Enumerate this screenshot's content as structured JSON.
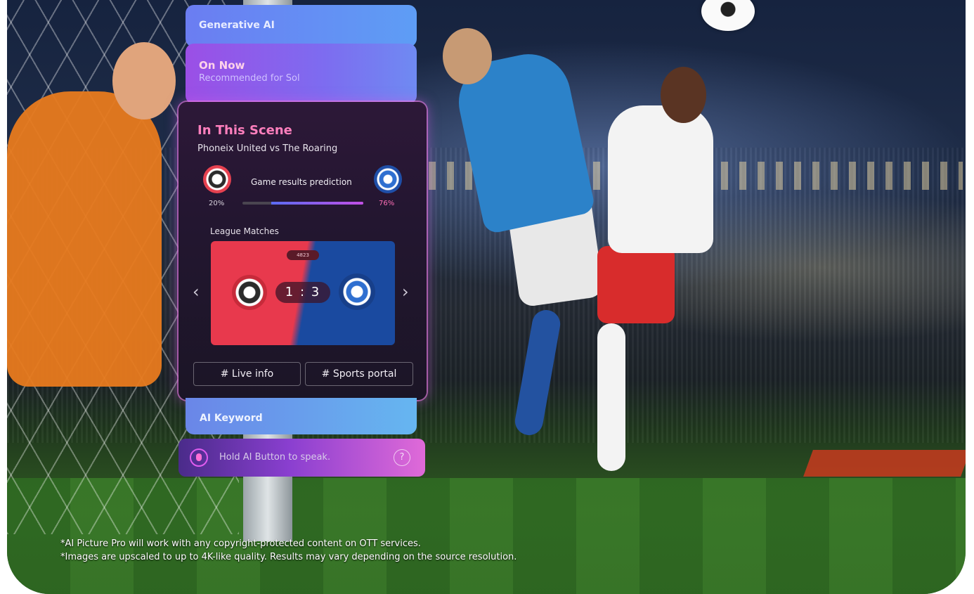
{
  "panel": {
    "generative_ai": "Generative AI",
    "on_now": {
      "title": "On Now",
      "subtitle": "Recommended for Sol"
    },
    "scene": {
      "title": "In This Scene",
      "match_title": "Phoneix United vs The Roaring",
      "prediction_label": "Game results prediction",
      "home_percent": "20%",
      "away_percent": "76%",
      "away_fraction": 0.76,
      "league_label": "League Matches",
      "match_badge": "4823",
      "score_home": "1",
      "score_sep": ":",
      "score_away": "3",
      "prev_arrow": "‹",
      "next_arrow": "›",
      "chips": [
        "# Live info",
        "# Sports portal"
      ]
    },
    "ai_keyword": "AI Keyword",
    "speak_prompt": "Hold AI Button to speak.",
    "help_glyph": "?"
  },
  "disclaimers": [
    "*AI Picture Pro will work with any copyright-protected content on OTT services.",
    "*Images are upscaled to up to 4K-like quality. Results may vary depending on the source resolution."
  ],
  "colors": {
    "accent_pink": "#ff7fbd",
    "home_team": "#e8394d",
    "away_team": "#1a4aa0"
  },
  "icons": {
    "mic": "mic-icon",
    "help": "help-icon",
    "home_logo": "phoenix-united-logo",
    "away_logo": "the-roaring-logo"
  }
}
